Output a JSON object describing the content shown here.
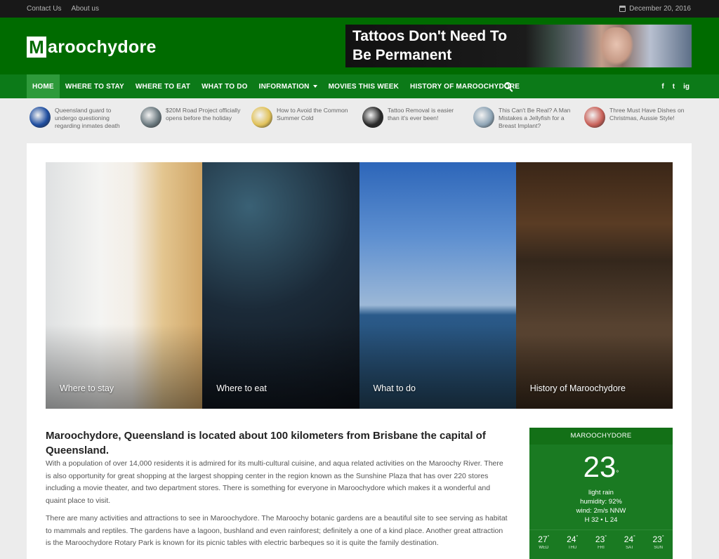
{
  "topbar": {
    "links": [
      "Contact Us",
      "About us"
    ],
    "date": "December 20, 2016"
  },
  "header": {
    "logo_letter": "M",
    "logo_text": "aroochydore",
    "banner_line1": "Tattoos Don't Need To",
    "banner_line2": "Be Permanent"
  },
  "nav": {
    "items": [
      "HOME",
      "WHERE TO STAY",
      "WHERE TO EAT",
      "WHAT TO DO",
      "INFORMATION",
      "MOVIES THIS WEEK",
      "HISTORY OF MAROOCHYDORE"
    ],
    "social": [
      "f",
      "t",
      "ig"
    ]
  },
  "ticker": [
    {
      "text": "Queensland guard to undergo questioning regarding inmates death",
      "color": "#1f4ea0"
    },
    {
      "text": "$20M Road Project officially opens before the holiday",
      "color": "#6c7a80"
    },
    {
      "text": "How to Avoid the Common Summer Cold",
      "color": "#e1c25a"
    },
    {
      "text": "Tattoo Removal is easier than it's ever been!",
      "color": "#2a2a2a"
    },
    {
      "text": "This Can't Be Real? A Man Mistakes a Jellyfish for a Breast Implant?",
      "color": "#8fa5b6"
    },
    {
      "text": "Three Must Have Dishes on Christmas, Aussie Style!",
      "color": "#c9625a"
    }
  ],
  "tiles": [
    "Where to stay",
    "Where to eat",
    "What to do",
    "History of Maroochydore"
  ],
  "article": {
    "title": "Maroochydore, Queensland is located about 100 kilometers from Brisbane the capital of Queensland.",
    "para1": "With a population of over 14,000 residents it is admired for its multi-cultural cuisine, and aqua related activities on the Maroochy River. There is also opportunity for great shopping at the largest shopping center in the region known as the Sunshine Plaza that has over 220 stores including a movie theater, and two department stores. There is something for everyone in Maroochydore which makes it a wonderful and quaint place to visit.",
    "para2": "There are many activities and attractions to see in Maroochydore. The Maroochy botanic gardens are a beautiful site to see serving as habitat to mammals and reptiles. The gardens have a lagoon, bushland and even rainforest; definitely a one of a kind place. Another great attraction is the Maroochydore Rotary Park is known for its picnic tables with electric barbeques so it is quite the family destination."
  },
  "weather": {
    "location": "MAROOCHYDORE",
    "temp": "23",
    "desc": "light rain",
    "humidity": "humidity: 92%",
    "wind": "wind: 2m/s NNW",
    "hl": "H 32 • L 24",
    "forecast": [
      {
        "t": "27",
        "d": "WED"
      },
      {
        "t": "24",
        "d": "THU"
      },
      {
        "t": "23",
        "d": "FRI"
      },
      {
        "t": "24",
        "d": "SAT"
      },
      {
        "t": "23",
        "d": "SUN"
      }
    ]
  }
}
